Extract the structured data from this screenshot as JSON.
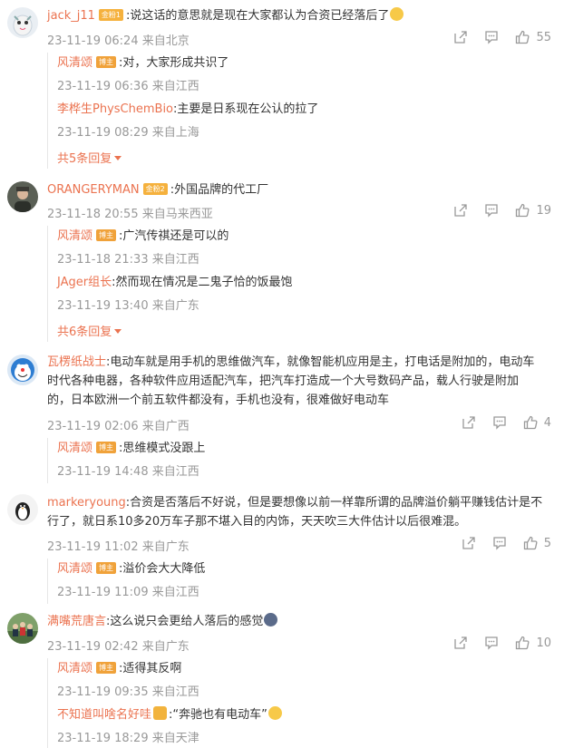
{
  "comments": [
    {
      "user": "jack_j11",
      "badge": "金粉1",
      "text": ":说这话的意思就是现在大家都认为合资已经落后了",
      "time": "23-11-19 06:24 来自北京",
      "likes": "55",
      "replies": [
        {
          "user": "风清颂",
          "badge": "博主",
          "text": ":对，大家形成共识了",
          "time": "23-11-19 06:36 来自江西"
        },
        {
          "user": "李桦生PhysChemBio",
          "text": ":主要是日系现在公认的拉了",
          "time": "23-11-19 08:29 来自上海"
        }
      ],
      "more": "共5条回复"
    },
    {
      "user": "ORANGERYMAN",
      "badge": "金粉2",
      "text": ":外国品牌的代工厂",
      "time": "23-11-18 20:55 来自马来西亚",
      "likes": "19",
      "replies": [
        {
          "user": "风清颂",
          "badge": "博主",
          "text": ":广汽传祺还是可以的",
          "time": "23-11-18 21:33 来自江西"
        },
        {
          "user": "JAger组长",
          "text": ":然而现在情况是二鬼子恰的饭最饱",
          "time": "23-11-19 13:40 来自广东"
        }
      ],
      "more": "共6条回复"
    },
    {
      "user": "瓦楞纸战士",
      "text_lines": [
        ":电动车就是用手机的思维做汽车，就像智能机应用是主，打电话是附加的，电动车",
        "时代各种电器，各种软件应用适配汽车，把汽车打造成一个大号数码产品，载人行驶是附加",
        "的，日本欧洲一个前五软件都没有，手机也没有，很难做好电动车"
      ],
      "time": "23-11-19 02:06 来自广西",
      "likes": "4",
      "replies": [
        {
          "user": "风清颂",
          "badge": "博主",
          "text": ":思维模式没跟上",
          "time": "23-11-19 14:48 来自江西"
        }
      ]
    },
    {
      "user": "markeryoung",
      "text_lines": [
        ":合资是否落后不好说，但是要想像以前一样靠所谓的品牌溢价躺平赚钱估计是不",
        "行了，就日系10多20万车子那不堪入目的内饰，天天吹三大件估计以后很难混。"
      ],
      "time": "23-11-19 11:02 来自广东",
      "likes": "5",
      "replies": [
        {
          "user": "风清颂",
          "badge": "博主",
          "text": ":溢价会大大降低",
          "time": "23-11-19 11:09 来自江西"
        }
      ]
    },
    {
      "user": "满嘴荒唐言",
      "text": ":这么说只会更给人落后的感觉",
      "time": "23-11-19 02:42 来自广东",
      "likes": "10",
      "replies": [
        {
          "user": "风清颂",
          "badge": "博主",
          "text": ":适得其反啊",
          "time": "23-11-19 09:35 来自江西"
        },
        {
          "user": "不知道叫啥名好哇",
          "text": ":“奔驰也有电动车”",
          "time": "23-11-19 18:29 来自天津"
        }
      ]
    }
  ]
}
